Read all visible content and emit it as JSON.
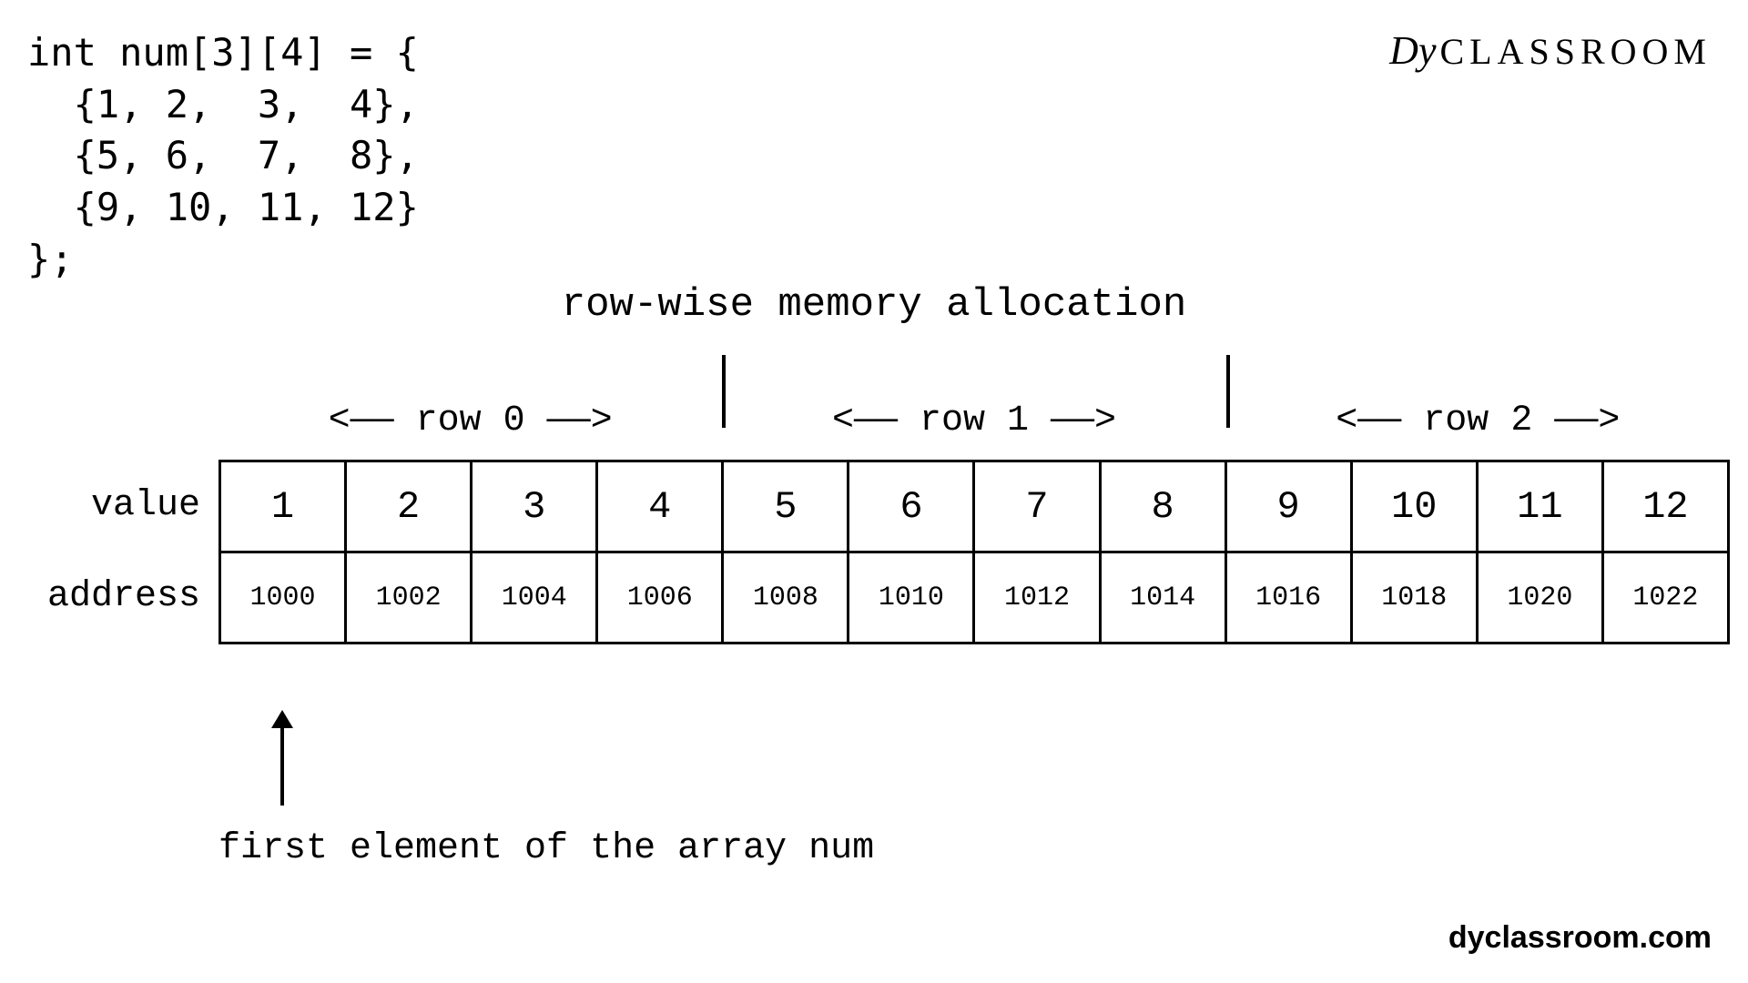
{
  "code": "int num[3][4] = {\n  {1, 2,  3,  4},\n  {5, 6,  7,  8},\n  {9, 10, 11, 12}\n};",
  "logo": {
    "prefix": "Dy",
    "text": "CLASSROOM"
  },
  "title": "row-wise memory allocation",
  "row_headers": [
    "<—— row 0 ——>",
    "<—— row 1 ——>",
    "<—— row 2 ——>"
  ],
  "labels": {
    "value": "value",
    "address": "address"
  },
  "chart_data": {
    "type": "table",
    "rows": 3,
    "cols": 4,
    "values": [
      1,
      2,
      3,
      4,
      5,
      6,
      7,
      8,
      9,
      10,
      11,
      12
    ],
    "addresses": [
      1000,
      1002,
      1004,
      1006,
      1008,
      1010,
      1012,
      1014,
      1016,
      1018,
      1020,
      1022
    ]
  },
  "annotation": "first element of the array num",
  "footer": "dyclassroom.com"
}
